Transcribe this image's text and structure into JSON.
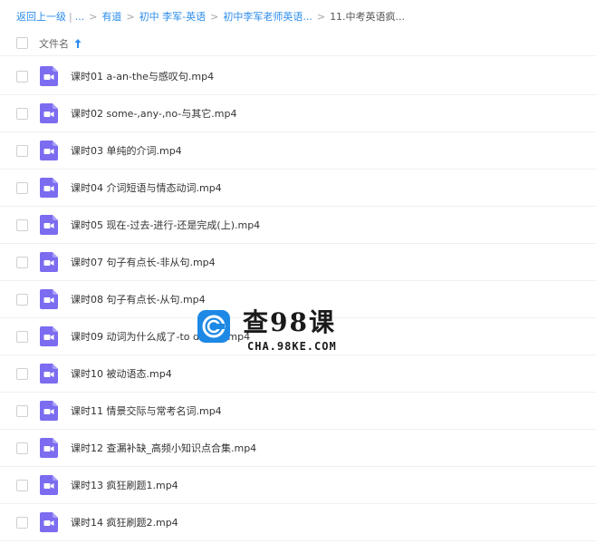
{
  "breadcrumb": {
    "back": "返回上一级",
    "divider": "|",
    "ellipsis": "...",
    "sep": ">",
    "items": [
      "有道",
      "初中 李军-英语",
      "初中李军老师英语..."
    ],
    "current": "11.中考英语疯..."
  },
  "header": {
    "name_label": "文件名",
    "sort": "ascending",
    "sort_color": "#2a8cec"
  },
  "files": [
    {
      "name": "课时01 a-an-the与感叹句.mp4",
      "type": "video"
    },
    {
      "name": "课时02 some-,any-,no-与其它.mp4",
      "type": "video"
    },
    {
      "name": "课时03 单纯的介词.mp4",
      "type": "video"
    },
    {
      "name": "课时04 介词短语与情态动词.mp4",
      "type": "video"
    },
    {
      "name": "课时05 现在-过去-进行-还是完成(上).mp4",
      "type": "video"
    },
    {
      "name": "课时07 句子有点长-非从句.mp4",
      "type": "video"
    },
    {
      "name": "课时08 句子有点长-从句.mp4",
      "type": "video"
    },
    {
      "name": "课时09 动词为什么成了-to do-ing.mp4",
      "type": "video"
    },
    {
      "name": "课时10 被动语态.mp4",
      "type": "video"
    },
    {
      "name": "课时11 情景交际与常考名词.mp4",
      "type": "video"
    },
    {
      "name": "课时12 查漏补缺_高频小知识点合集.mp4",
      "type": "video"
    },
    {
      "name": "课时13 疯狂刷题1.mp4",
      "type": "video"
    },
    {
      "name": "课时14 疯狂刷题2.mp4",
      "type": "video"
    }
  ],
  "icon_color": "#7b6cf0",
  "watermark": {
    "title": "查98课",
    "subtitle": "CHA.98KE.COM",
    "color": "#1e88e5"
  }
}
